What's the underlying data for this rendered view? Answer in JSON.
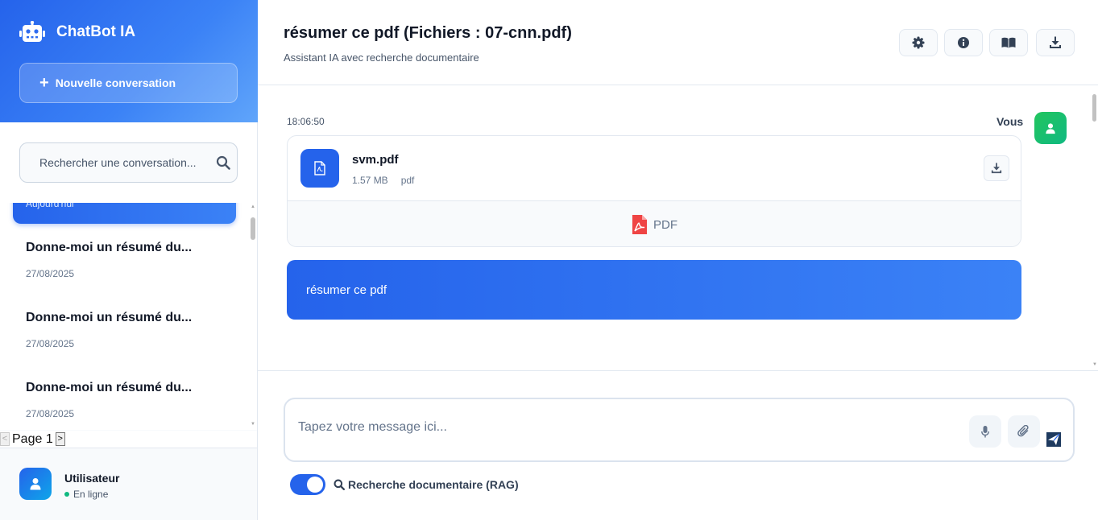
{
  "sidebar": {
    "brand": "ChatBot IA",
    "new_conversation": "Nouvelle conversation",
    "search_placeholder": "Rechercher une conversation...",
    "active_date": "Aujourd'hui",
    "conversations": [
      {
        "title": "Donne-moi un résumé du...",
        "date": "27/08/2025"
      },
      {
        "title": "Donne-moi un résumé du...",
        "date": "27/08/2025"
      },
      {
        "title": "Donne-moi un résumé du...",
        "date": "27/08/2025"
      }
    ],
    "pager": {
      "label": "Page 1",
      "prev": "<",
      "next": ">"
    },
    "user": {
      "name": "Utilisateur",
      "status": "En ligne"
    }
  },
  "header": {
    "title": "résumer ce pdf (Fichiers : 07-cnn.pdf)",
    "subtitle": "Assistant IA avec recherche documentaire",
    "buttons": [
      "gear-icon",
      "info-icon",
      "book-icon",
      "download-icon"
    ]
  },
  "messages": {
    "time": "18:06:50",
    "sender": "Vous",
    "file": {
      "name": "svm.pdf",
      "size": "1.57 MB",
      "type": "pdf",
      "preview_label": "PDF"
    },
    "text": "résumer ce pdf"
  },
  "composer": {
    "placeholder": "Tapez votre message ici...",
    "rag_label": "Recherche documentaire (RAG)",
    "rag_enabled": true
  },
  "colors": {
    "accent": "#2563eb",
    "user_avatar": "#22c55e",
    "pdf_red": "#ef4444"
  }
}
